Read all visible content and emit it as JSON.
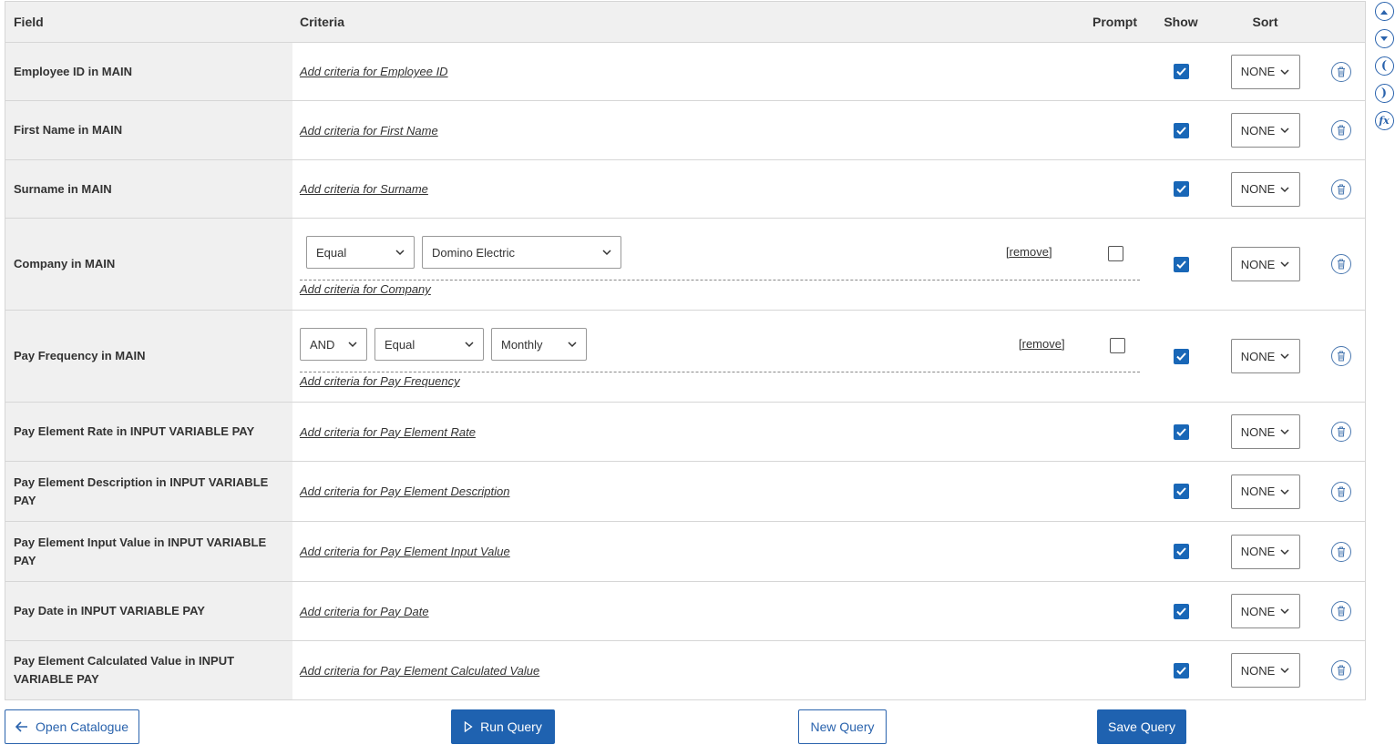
{
  "header": {
    "field": "Field",
    "criteria": "Criteria",
    "prompt": "Prompt",
    "show": "Show",
    "sort": "Sort"
  },
  "rows": [
    {
      "field": "Employee ID in MAIN",
      "add": "Add criteria for Employee ID",
      "sort": "NONE",
      "show": true
    },
    {
      "field": "First Name in MAIN",
      "add": "Add criteria for First Name",
      "sort": "NONE",
      "show": true
    },
    {
      "field": "Surname in MAIN",
      "add": "Add criteria for Surname",
      "sort": "NONE",
      "show": true
    },
    {
      "field": "Company in MAIN",
      "add": "Add criteria for Company",
      "sort": "NONE",
      "show": true,
      "criterion": {
        "operator": "Equal",
        "value": "Domino Electric",
        "remove": "[remove]",
        "prompt": false
      }
    },
    {
      "field": "Pay Frequency in MAIN",
      "add": "Add criteria for Pay Frequency",
      "sort": "NONE",
      "show": true,
      "criterion": {
        "conjunction": "AND",
        "operator": "Equal",
        "value": "Monthly",
        "remove": "[remove]",
        "prompt": false
      }
    },
    {
      "field": "Pay Element Rate in INPUT VARIABLE PAY",
      "add": "Add criteria for Pay Element Rate",
      "sort": "NONE",
      "show": true
    },
    {
      "field": "Pay Element Description in INPUT VARIABLE PAY",
      "add": "Add criteria for Pay Element Description",
      "sort": "NONE",
      "show": true
    },
    {
      "field": "Pay Element Input Value in INPUT VARIABLE PAY",
      "add": "Add criteria for Pay Element Input Value",
      "sort": "NONE",
      "show": true
    },
    {
      "field": "Pay Date in INPUT VARIABLE PAY",
      "add": "Add criteria for Pay Date",
      "sort": "NONE",
      "show": true
    },
    {
      "field": "Pay Element Calculated Value in INPUT VARIABLE PAY",
      "add": "Add criteria for Pay Element Calculated Value",
      "sort": "NONE",
      "show": true
    }
  ],
  "side_tools": [
    "move-up-icon",
    "move-down-icon",
    "open-paren-icon",
    "close-paren-icon",
    "function-icon"
  ],
  "side_tool_glyphs": {
    "open": "(",
    "close": ")",
    "fx": "fx"
  },
  "footer": {
    "open_catalogue": "Open Catalogue",
    "run_query": "Run Query",
    "new_query": "New Query",
    "save_query": "Save Query"
  },
  "colors": {
    "accent": "#1f62b0",
    "header_bg": "#f0f0f0"
  }
}
